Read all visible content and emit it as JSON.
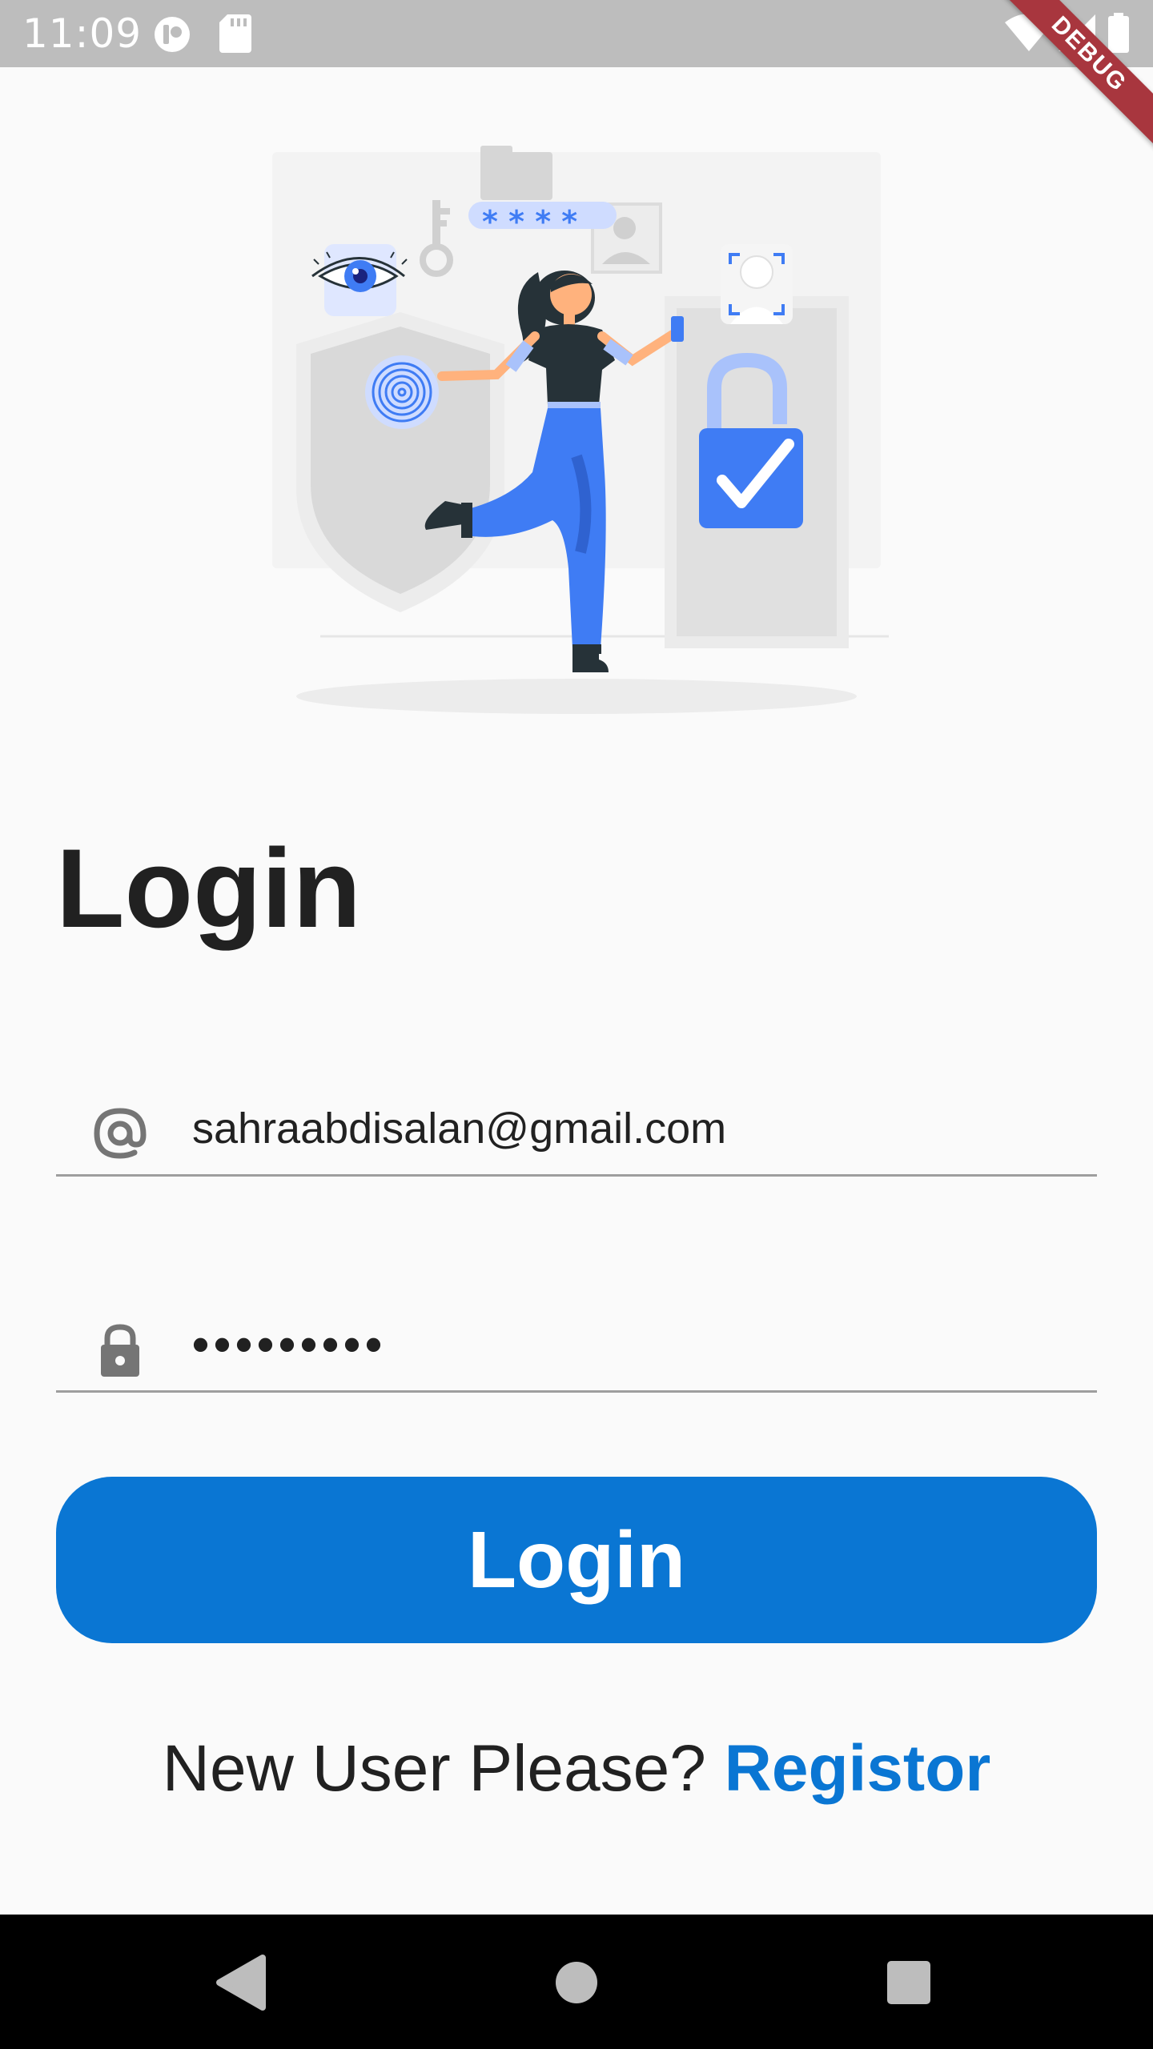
{
  "status_bar": {
    "time": "11:09",
    "icons": [
      "camera-app-icon",
      "sd-card-icon",
      "wifi-icon",
      "signal-icon",
      "battery-icon"
    ],
    "debug_label": "DEBUG"
  },
  "illustration": {
    "icon": "security-login-illustration",
    "password_stars": "* * * *"
  },
  "login": {
    "title": "Login",
    "email": {
      "icon": "at-sign-icon",
      "value": "sahraabdisalan@gmail.com"
    },
    "password": {
      "icon": "lock-icon",
      "value": "•••••••••"
    },
    "button_label": "Login",
    "register_prompt": "New User Please?",
    "register_link": "Registor"
  },
  "nav_bar": {
    "icons": [
      "back-icon",
      "home-icon",
      "recents-icon"
    ]
  },
  "colors": {
    "accent": "#0a76d3",
    "status_bar": "#bdbdbd",
    "illustration_blue": "#3f7cf4",
    "text": "#212121"
  }
}
